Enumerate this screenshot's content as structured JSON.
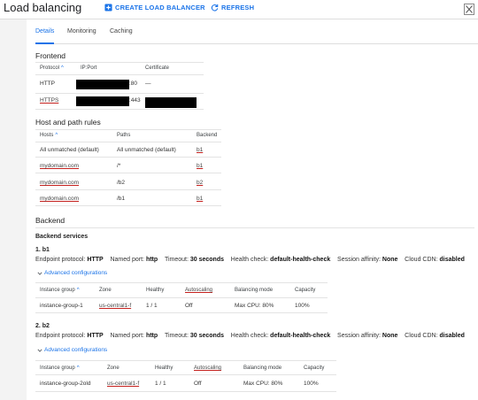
{
  "header": {
    "title": "Load balancing",
    "create_label": "CREATE LOAD BALANCER",
    "refresh_label": "REFRESH"
  },
  "tabs": [
    "Details",
    "Monitoring",
    "Caching"
  ],
  "frontend": {
    "title": "Frontend",
    "headers": [
      "Protocol",
      "IP:Port",
      "Certificate"
    ],
    "rows": [
      {
        "protocol": "HTTP",
        "port": ":80",
        "certificate": "—"
      },
      {
        "protocol": "HTTPS",
        "port": ":443",
        "certificate": ""
      }
    ]
  },
  "host_path": {
    "title": "Host and path rules",
    "headers": [
      "Hosts",
      "Paths",
      "Backend"
    ],
    "rows": [
      {
        "hosts": "All unmatched (default)",
        "paths": "All unmatched (default)",
        "backend": "b1"
      },
      {
        "hosts": "mydomain.com",
        "paths": "/*",
        "backend": "b1"
      },
      {
        "hosts": "mydomain.com",
        "paths": "/b2",
        "backend": "b2"
      },
      {
        "hosts": "mydomain.com",
        "paths": "/b1",
        "backend": "b1"
      }
    ]
  },
  "backend": {
    "title": "Backend",
    "services_label": "Backend services",
    "services": [
      {
        "name": "1. b1",
        "endpoint_protocol_label": "Endpoint protocol:",
        "endpoint_protocol": "HTTP",
        "named_port_label": "Named port:",
        "named_port": "http",
        "timeout_label": "Timeout:",
        "timeout": "30 seconds",
        "health_check_label": "Health check:",
        "health_check": "default-health-check",
        "session_affinity_label": "Session affinity:",
        "session_affinity": "None",
        "cdn_label": "Cloud CDN:",
        "cdn": "disabled",
        "advanced_label": "Advanced configurations",
        "headers": [
          "Instance group",
          "Zone",
          "Healthy",
          "Autoscaling",
          "Balancing mode",
          "Capacity"
        ],
        "row": {
          "group": "instance-group-1",
          "zone": "us-central1-f",
          "healthy": "1 / 1",
          "autoscaling": "Off",
          "mode": "Max CPU: 80%",
          "capacity": "100%"
        }
      },
      {
        "name": "2. b2",
        "endpoint_protocol_label": "Endpoint protocol:",
        "endpoint_protocol": "HTTP",
        "named_port_label": "Named port:",
        "named_port": "http",
        "timeout_label": "Timeout:",
        "timeout": "30 seconds",
        "health_check_label": "Health check:",
        "health_check": "default-health-check",
        "session_affinity_label": "Session affinity:",
        "session_affinity": "None",
        "cdn_label": "Cloud CDN:",
        "cdn": "disabled",
        "advanced_label": "Advanced configurations",
        "headers": [
          "Instance group",
          "Zone",
          "Healthy",
          "Autoscaling",
          "Balancing mode",
          "Capacity"
        ],
        "row": {
          "group": "instance-group-2old",
          "zone": "us-central1-f",
          "healthy": "1 / 1",
          "autoscaling": "Off",
          "mode": "Max CPU: 80%",
          "capacity": "100%"
        }
      }
    ]
  },
  "colors": {
    "accent": "#1a73e8",
    "link_underline": "#c5221f"
  },
  "icons": [
    "add-box-icon",
    "refresh-icon",
    "more-vert-icon",
    "sort-up-icon",
    "chevron-down-icon"
  ]
}
